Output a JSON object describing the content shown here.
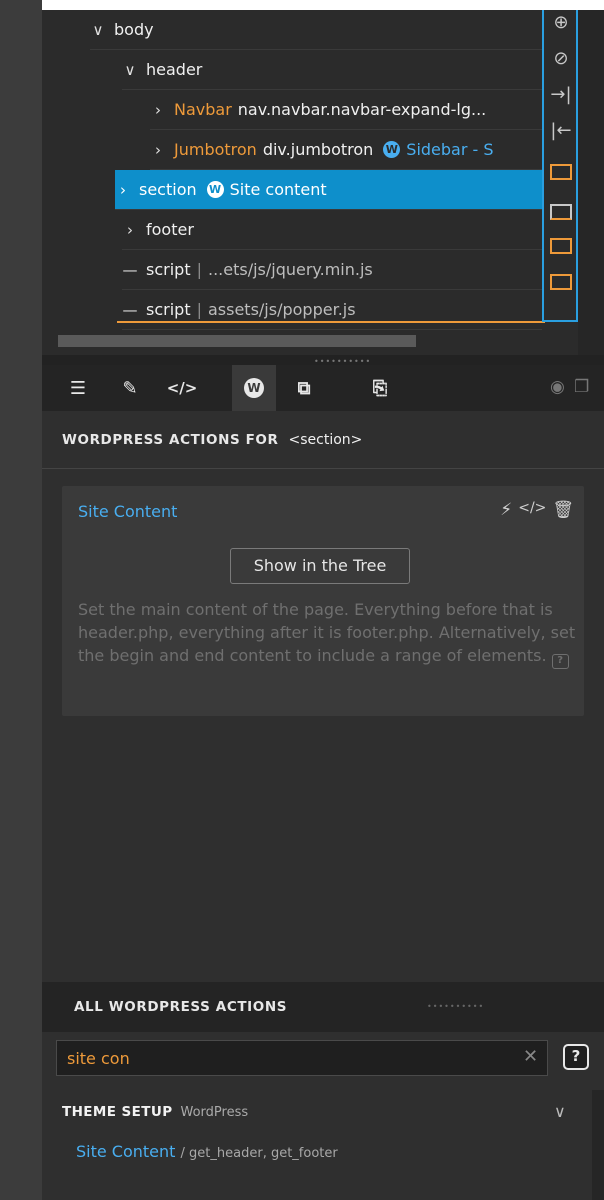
{
  "tree": {
    "rows": [
      {
        "chev": "∨",
        "tag": "body"
      },
      {
        "chev": "∨",
        "tag": "header"
      },
      {
        "chev": "›",
        "name": "Navbar",
        "tag": "nav.navbar.navbar-expand-lg..."
      },
      {
        "chev": "›",
        "name": "Jumbotron",
        "tag": "div.jumbotron",
        "wp": "Sidebar - S"
      },
      {
        "chev": "›",
        "tag": "section",
        "wp": "Site content",
        "selected": true
      },
      {
        "chev": "›",
        "tag": "footer"
      },
      {
        "chev": "—",
        "tag": "script",
        "path": "...ets/js/jquery.min.js"
      },
      {
        "chev": "—",
        "tag": "script",
        "path": "assets/js/popper.js"
      }
    ]
  },
  "tools": [
    "insert-icon",
    "hide-icon",
    "indent-right-icon",
    "indent-left-icon",
    "insert-before-icon",
    "insert-after-icon",
    "prepend-icon",
    "append-icon"
  ],
  "toolbar": {
    "tabs": [
      "properties",
      "style",
      "code",
      "wordpress",
      "components",
      "export"
    ],
    "active": "wordpress"
  },
  "wp_actions": {
    "title": "WORDPRESS ACTIONS FOR",
    "element": "<section>",
    "card": {
      "title": "Site Content",
      "button": "Show in the Tree",
      "description": "Set the main content of the page. Everything before that is header.php, everything after it is footer.php. Alternatively, set the begin and end content to include a range of elements."
    }
  },
  "all_actions": {
    "title": "ALL WORDPRESS ACTIONS",
    "search_value": "site con",
    "group": {
      "title": "THEME SETUP",
      "sub": "WordPress"
    },
    "item": {
      "name": "Site Content",
      "hooks": "/ get_header, get_footer"
    }
  },
  "colors": {
    "accent": "#0e8fcb",
    "orange": "#ee9a3a",
    "link": "#49aef0"
  }
}
